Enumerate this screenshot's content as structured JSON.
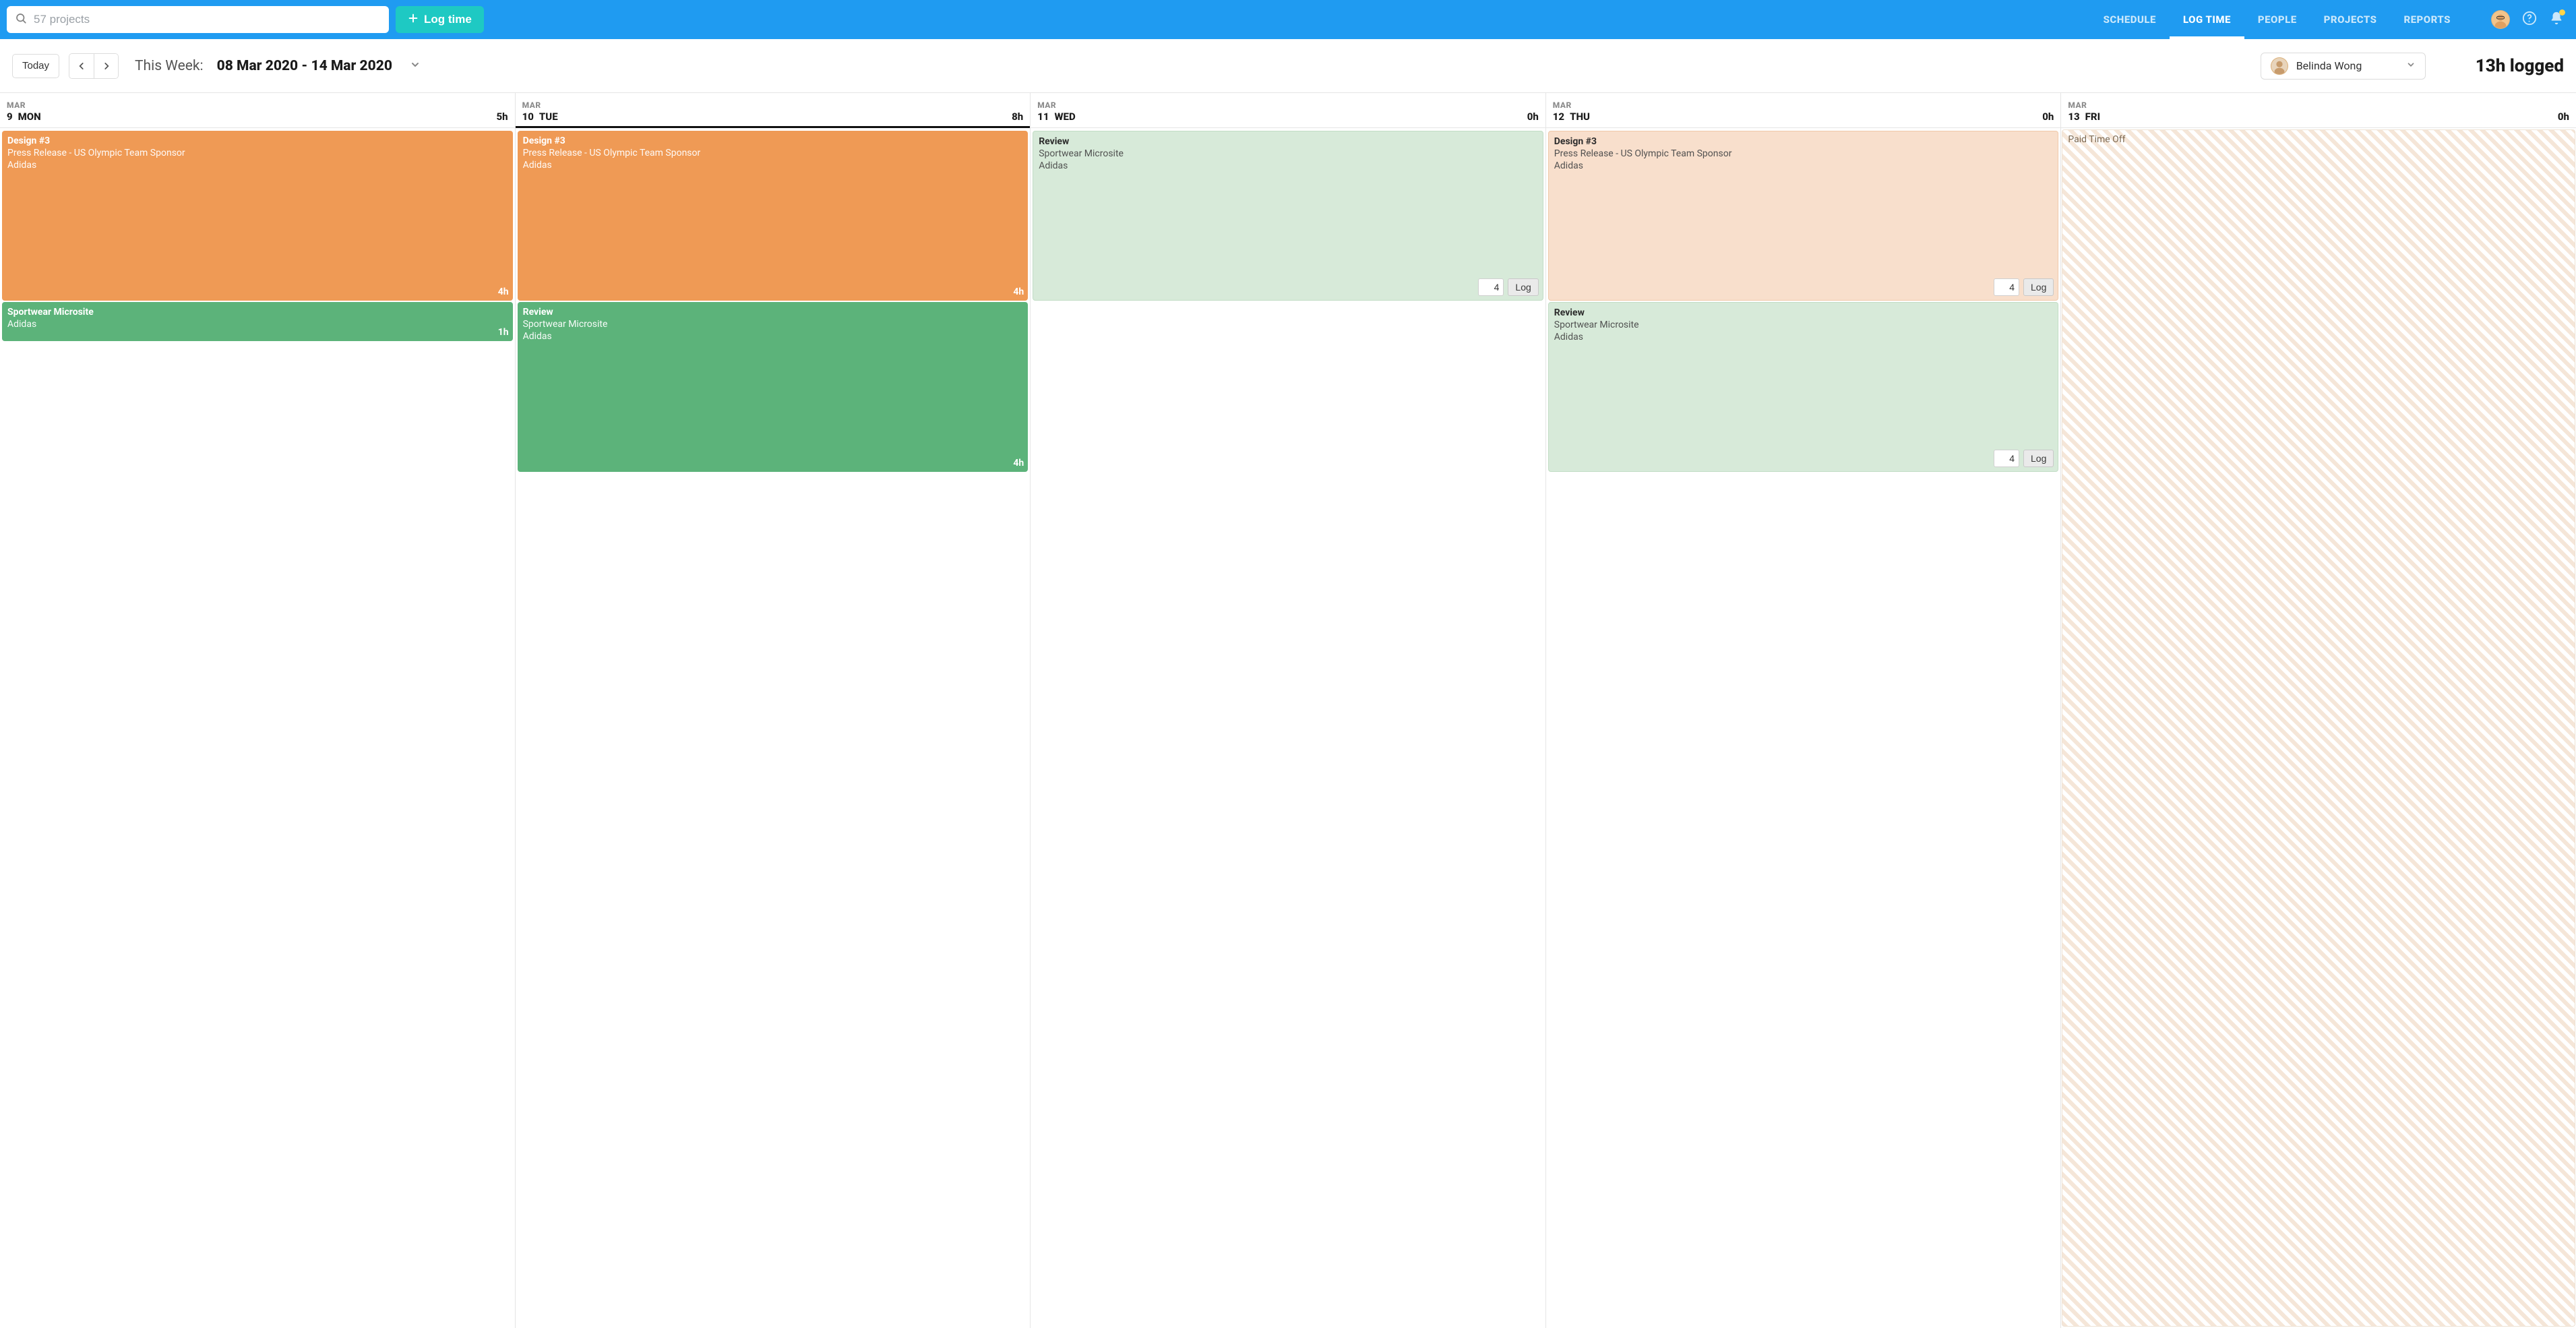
{
  "topbar": {
    "search_placeholder": "57 projects",
    "log_time_label": "Log time",
    "nav": [
      {
        "label": "SCHEDULE",
        "active": false
      },
      {
        "label": "LOG TIME",
        "active": true
      },
      {
        "label": "PEOPLE",
        "active": false
      },
      {
        "label": "PROJECTS",
        "active": false
      },
      {
        "label": "REPORTS",
        "active": false
      }
    ]
  },
  "subheader": {
    "today_label": "Today",
    "week_label": "This Week:",
    "week_range": "08 Mar 2020 - 14 Mar 2020",
    "person_name": "Belinda Wong",
    "logged_total": "13h logged"
  },
  "log_button_label": "Log",
  "days": [
    {
      "month": "MAR",
      "num": "9",
      "name": "MON",
      "hours": "5h",
      "active": false,
      "cards": [
        {
          "title": "Design #3",
          "sub": "Press Release - US Olympic Team Sponsor",
          "client": "Adidas",
          "color": "orange",
          "style": "solid",
          "height": "h-4u",
          "hours": "4h"
        },
        {
          "title": "Sportwear Microsite",
          "sub": "",
          "client": "Adidas",
          "color": "green",
          "style": "solid",
          "height": "h-1u",
          "hours": "1h"
        }
      ]
    },
    {
      "month": "MAR",
      "num": "10",
      "name": "TUE",
      "hours": "8h",
      "active": true,
      "cards": [
        {
          "title": "Design #3",
          "sub": "Press Release - US Olympic Team Sponsor",
          "client": "Adidas",
          "color": "orange",
          "style": "solid",
          "height": "h-4u",
          "hours": "4h"
        },
        {
          "title": "Review",
          "sub": "Sportwear Microsite",
          "client": "Adidas",
          "color": "green",
          "style": "solid",
          "height": "h-4u",
          "hours": "4h"
        }
      ]
    },
    {
      "month": "MAR",
      "num": "11",
      "name": "WED",
      "hours": "0h",
      "active": false,
      "cards": [
        {
          "title": "Review",
          "sub": "Sportwear Microsite",
          "client": "Adidas",
          "color": "green",
          "style": "faint",
          "height": "h-4u",
          "log_value": "4"
        }
      ]
    },
    {
      "month": "MAR",
      "num": "12",
      "name": "THU",
      "hours": "0h",
      "active": false,
      "cards": [
        {
          "title": "Design #3",
          "sub": "Press Release - US Olympic Team Sponsor",
          "client": "Adidas",
          "color": "orange",
          "style": "faint",
          "height": "h-4u",
          "log_value": "4"
        },
        {
          "title": "Review",
          "sub": "Sportwear Microsite",
          "client": "Adidas",
          "color": "green",
          "style": "faint",
          "height": "h-4u",
          "log_value": "4"
        }
      ]
    },
    {
      "month": "MAR",
      "num": "13",
      "name": "FRI",
      "hours": "0h",
      "active": false,
      "pto_label": "Paid Time Off"
    }
  ]
}
